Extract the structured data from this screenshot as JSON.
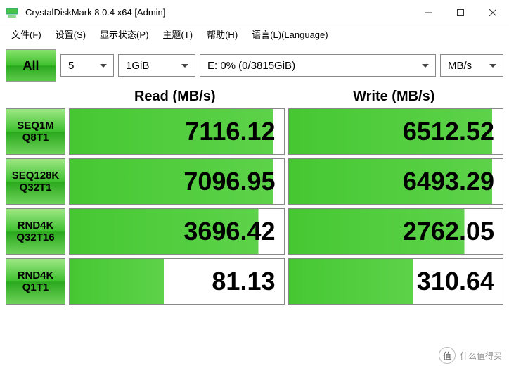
{
  "window": {
    "title": "CrystalDiskMark 8.0.4 x64 [Admin]"
  },
  "menu": {
    "file": {
      "text": "文件",
      "key": "F"
    },
    "setup": {
      "text": "设置",
      "key": "S"
    },
    "profile": {
      "text": "显示状态",
      "key": "P"
    },
    "theme": {
      "text": "主题",
      "key": "T"
    },
    "help": {
      "text": "帮助",
      "key": "H"
    },
    "lang": {
      "text": "语言",
      "key": "L",
      "suffix": "(Language)"
    }
  },
  "toolbar": {
    "all": "All",
    "count": "5",
    "size": "1GiB",
    "drive": "E: 0% (0/3815GiB)",
    "unit": "MB/s"
  },
  "headers": {
    "read": "Read (MB/s)",
    "write": "Write (MB/s)"
  },
  "tests": [
    {
      "line1": "SEQ1M",
      "line2": "Q8T1",
      "read": "7116.12",
      "read_fill": 95,
      "write": "6512.52",
      "write_fill": 95
    },
    {
      "line1": "SEQ128K",
      "line2": "Q32T1",
      "read": "7096.95",
      "read_fill": 95,
      "write": "6493.29",
      "write_fill": 95
    },
    {
      "line1": "RND4K",
      "line2": "Q32T16",
      "read": "3696.42",
      "read_fill": 88,
      "write": "2762.05",
      "write_fill": 82
    },
    {
      "line1": "RND4K",
      "line2": "Q1T1",
      "read": "81.13",
      "read_fill": 44,
      "write": "310.64",
      "write_fill": 58
    }
  ],
  "watermark": {
    "badge": "值",
    "text": "什么值得买"
  },
  "chart_data": {
    "type": "table",
    "title": "CrystalDiskMark 8.0.4 benchmark results",
    "unit": "MB/s",
    "drive": "E: 0% (0/3815GiB)",
    "test_size": "1GiB",
    "passes": 5,
    "columns": [
      "Test",
      "Read (MB/s)",
      "Write (MB/s)"
    ],
    "rows": [
      [
        "SEQ1M Q8T1",
        7116.12,
        6512.52
      ],
      [
        "SEQ128K Q32T1",
        7096.95,
        6493.29
      ],
      [
        "RND4K Q32T16",
        3696.42,
        2762.05
      ],
      [
        "RND4K Q1T1",
        81.13,
        310.64
      ]
    ]
  }
}
